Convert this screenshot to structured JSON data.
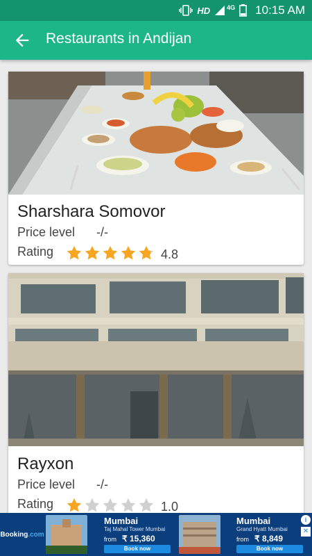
{
  "status_bar": {
    "hd": "HD",
    "network": "4G",
    "time": "10:15 AM"
  },
  "app_bar": {
    "title": "Restaurants in Andijan"
  },
  "restaurants": [
    {
      "name": "Sharshara Somovor",
      "price_label": "Price level",
      "price_value": "-/-",
      "rating_label": "Rating",
      "rating": 4.8,
      "rating_text": "4.8"
    },
    {
      "name": "Rayxon",
      "price_label": "Price level",
      "price_value": "-/-",
      "rating_label": "Rating",
      "rating": 1.0,
      "rating_text": "1.0"
    }
  ],
  "ad": {
    "brand": "Booking",
    "brand_suffix": ".com",
    "offers": [
      {
        "city": "Mumbai",
        "hotel": "Taj Mahal Tower Mumbai",
        "from": "from",
        "price": "₹ 15,360",
        "book": "Book now"
      },
      {
        "city": "Mumbai",
        "hotel": "Grand Hyatt Mumbai",
        "from": "from",
        "price": "₹ 8,849",
        "book": "Book now"
      }
    ]
  },
  "colors": {
    "status_bar": "#14936f",
    "app_bar": "#1db688",
    "star_filled": "#f7a623",
    "star_empty": "#d0d0d0"
  }
}
